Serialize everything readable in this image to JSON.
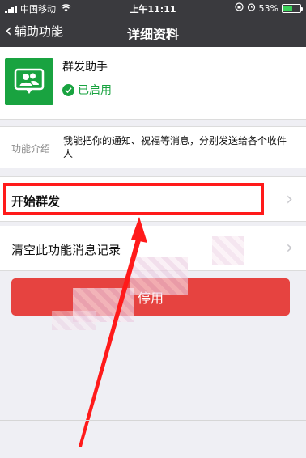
{
  "status_bar": {
    "carrier": "中国移动",
    "time": "上午11:11",
    "battery": "53%"
  },
  "nav": {
    "back_label": "辅助功能",
    "title": "详细资料"
  },
  "profile": {
    "name": "群发助手",
    "status": "已启用"
  },
  "intro": {
    "label": "功能介绍",
    "text": "我能把你的通知、祝福等消息，分别发送给各个收件人"
  },
  "rows": {
    "start_broadcast": "开始群发",
    "clear_history": "清空此功能消息记录"
  },
  "disable_button": {
    "label": "停用"
  },
  "colors": {
    "bar_bg": "#3a3a3e",
    "wechat_green": "#19a340",
    "danger_red": "#e64340",
    "annotation_red": "#ff1a1a"
  }
}
